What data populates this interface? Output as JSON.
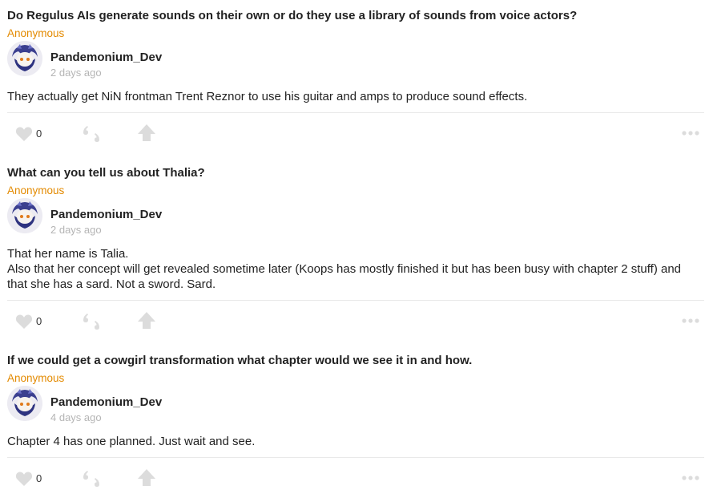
{
  "icons": {
    "like": "heart-icon",
    "quote": "quote-icon",
    "share": "share-arrow-up-icon",
    "more": "more-dots-icon"
  },
  "colors": {
    "asker": "#e38a00",
    "timestamp": "#b5b5b5",
    "icon": "#dcdcdc"
  },
  "posts": [
    {
      "question": "Do Regulus AIs generate sounds on their own or do they use a library of sounds from voice actors?",
      "asker": "Anonymous",
      "author": "Pandemonium_Dev",
      "time": "2 days ago",
      "answer": [
        "They actually get NiN frontman Trent Reznor to use his guitar and amps to produce sound effects."
      ],
      "likes": "0"
    },
    {
      "question": "What can you tell us about Thalia?",
      "asker": "Anonymous",
      "author": "Pandemonium_Dev",
      "time": "2 days ago",
      "answer": [
        "That her name is Talia.",
        "Also that her concept will get revealed sometime later (Koops has mostly finished it but has been busy with chapter 2 stuff) and that she has a sard. Not a sword. Sard."
      ],
      "likes": "0"
    },
    {
      "question": "If we could get a cowgirl transformation what chapter would we see it in and how.",
      "asker": "Anonymous",
      "author": "Pandemonium_Dev",
      "time": "4 days ago",
      "answer": [
        "Chapter 4 has one planned. Just wait and see."
      ],
      "likes": "0"
    }
  ]
}
